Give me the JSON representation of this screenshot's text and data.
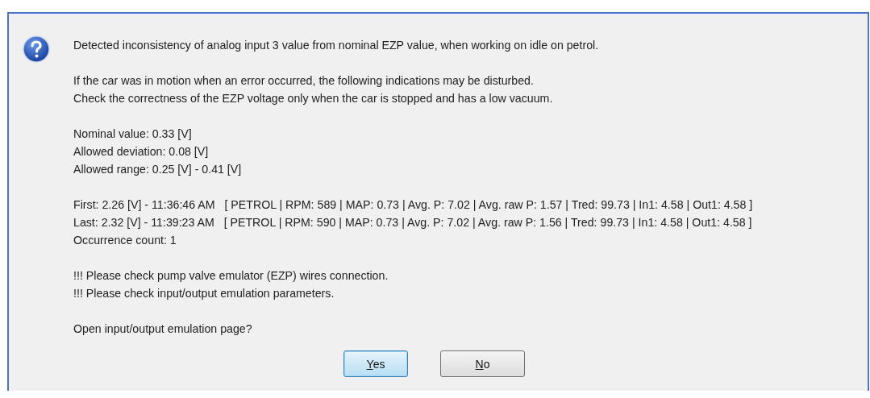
{
  "dialog": {
    "paragraphs": [
      [
        "Detected inconsistency of analog input 3 value from nominal EZP value, when working on idle on petrol."
      ],
      [
        "If the car was in motion when an error occurred, the following indications may be disturbed.",
        "Check the correctness of the EZP voltage only when the car is stopped and has a low vacuum."
      ],
      [
        "Nominal value: 0.33 [V]",
        "Allowed deviation: 0.08 [V]",
        "Allowed range: 0.25 [V] - 0.41 [V]"
      ],
      [
        "First: 2.26 [V] - 11:36:46 AM   [ PETROL | RPM: 589 | MAP: 0.73 | Avg. P: 7.02 | Avg. raw P: 1.57 | Tred: 99.73 | In1: 4.58 | Out1: 4.58 ]",
        "Last: 2.32 [V] - 11:39:23 AM   [ PETROL | RPM: 590 | MAP: 0.73 | Avg. P: 7.02 | Avg. raw P: 1.56 | Tred: 99.73 | In1: 4.58 | Out1: 4.58 ]",
        "Occurrence count: 1"
      ],
      [
        "!!! Please check pump valve emulator (EZP) wires connection.",
        "!!! Please check input/output emulation parameters."
      ],
      [
        "Open input/output emulation page?"
      ]
    ],
    "buttons": [
      {
        "label": "Yes",
        "default": true
      },
      {
        "label": "No",
        "default": false
      }
    ]
  }
}
